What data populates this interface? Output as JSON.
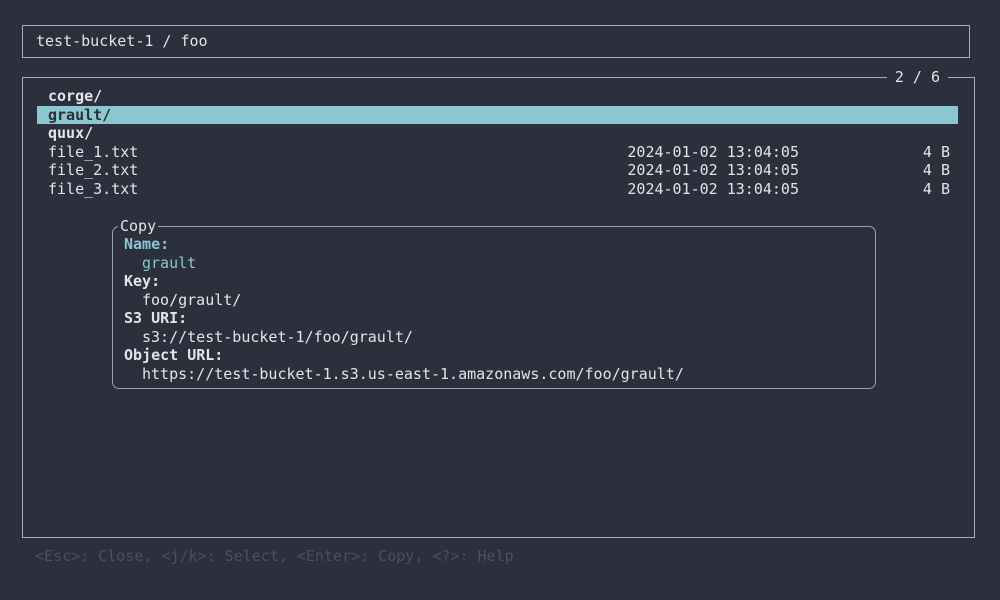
{
  "header": {
    "path": "test-bucket-1 / foo"
  },
  "list": {
    "counter": "2 / 6",
    "items": [
      {
        "name": "corge/",
        "type": "dir",
        "selected": false
      },
      {
        "name": "grault/",
        "type": "dir",
        "selected": true
      },
      {
        "name": "quux/",
        "type": "dir",
        "selected": false
      },
      {
        "name": "file_1.txt",
        "type": "file",
        "date": "2024-01-02 13:04:05",
        "size": "4 B"
      },
      {
        "name": "file_2.txt",
        "type": "file",
        "date": "2024-01-02 13:04:05",
        "size": "4 B"
      },
      {
        "name": "file_3.txt",
        "type": "file",
        "date": "2024-01-02 13:04:05",
        "size": "4 B"
      }
    ]
  },
  "dialog": {
    "title": "Copy",
    "fields": [
      {
        "label": "Name:",
        "value": "grault",
        "selected": true
      },
      {
        "label": "Key:",
        "value": "foo/grault/",
        "selected": false
      },
      {
        "label": "S3 URI:",
        "value": "s3://test-bucket-1/foo/grault/",
        "selected": false
      },
      {
        "label": "Object URL:",
        "value": "https://test-bucket-1.s3.us-east-1.amazonaws.com/foo/grault/",
        "selected": false
      }
    ]
  },
  "statusbar": {
    "hints": "<Esc>: Close, <j/k>: Select, <Enter>: Copy, <?>: Help"
  },
  "colors": {
    "background": "#2b303c",
    "foreground": "#e2e4e8",
    "accent_teal": "#8cc6d0",
    "selected_text": "#2b303c",
    "border": "#a6adb8",
    "dialog_border": "#99a1ae",
    "dim_text": "#49505f"
  }
}
